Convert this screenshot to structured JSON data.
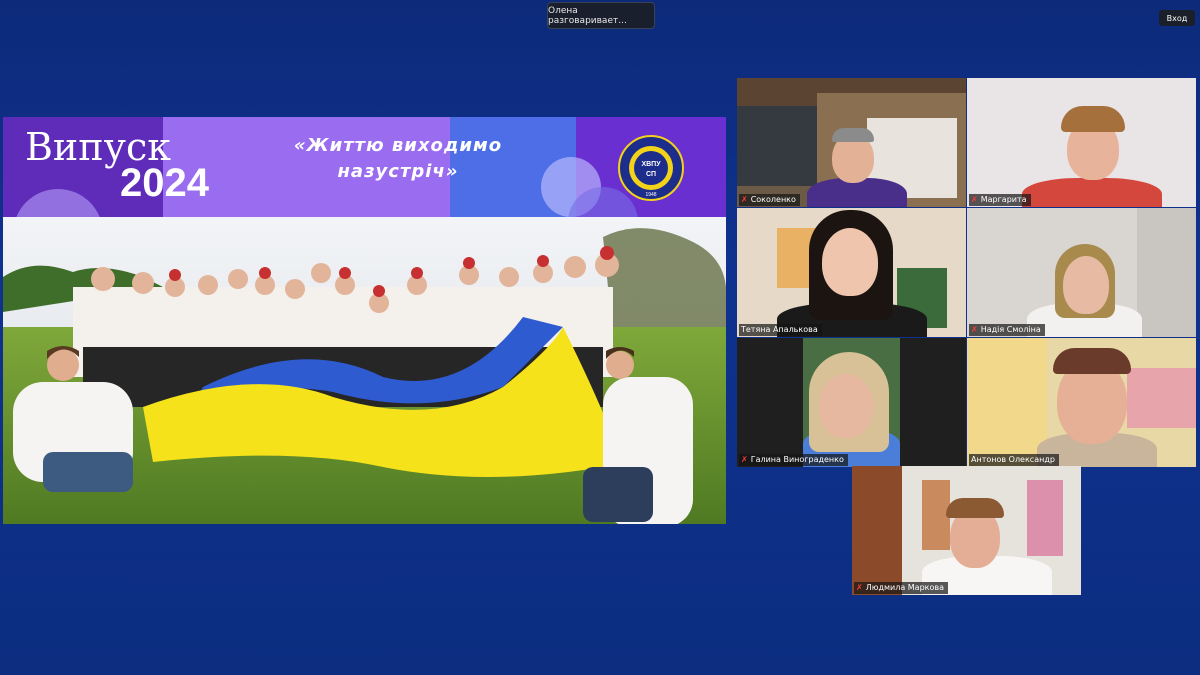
{
  "status": {
    "speaking": "Олена разговаривает..."
  },
  "header": {
    "login_label": "Вход"
  },
  "shared_screen": {
    "title_word": "Випуск",
    "title_year": "2024",
    "motto_line1": "«Життю виходимо",
    "motto_line2": "назустріч»",
    "logo_text": "ХВПУ СП",
    "logo_year": "1948"
  },
  "participants": [
    {
      "name": "Соколенко"
    },
    {
      "name": "Маргарита"
    },
    {
      "name": "Тетяна Апалькова"
    },
    {
      "name": "Надія Смоліна"
    },
    {
      "name": "Галина Винограденко"
    },
    {
      "name": "Антонов Олександр"
    },
    {
      "name": "Людмила Маркова"
    }
  ],
  "colors": {
    "background": "#0f3290",
    "banner_purple": "#6b33c9",
    "flag_blue": "#2f5bd1",
    "flag_yellow": "#f5e21a",
    "muted_mic": "#ff3d3d"
  }
}
